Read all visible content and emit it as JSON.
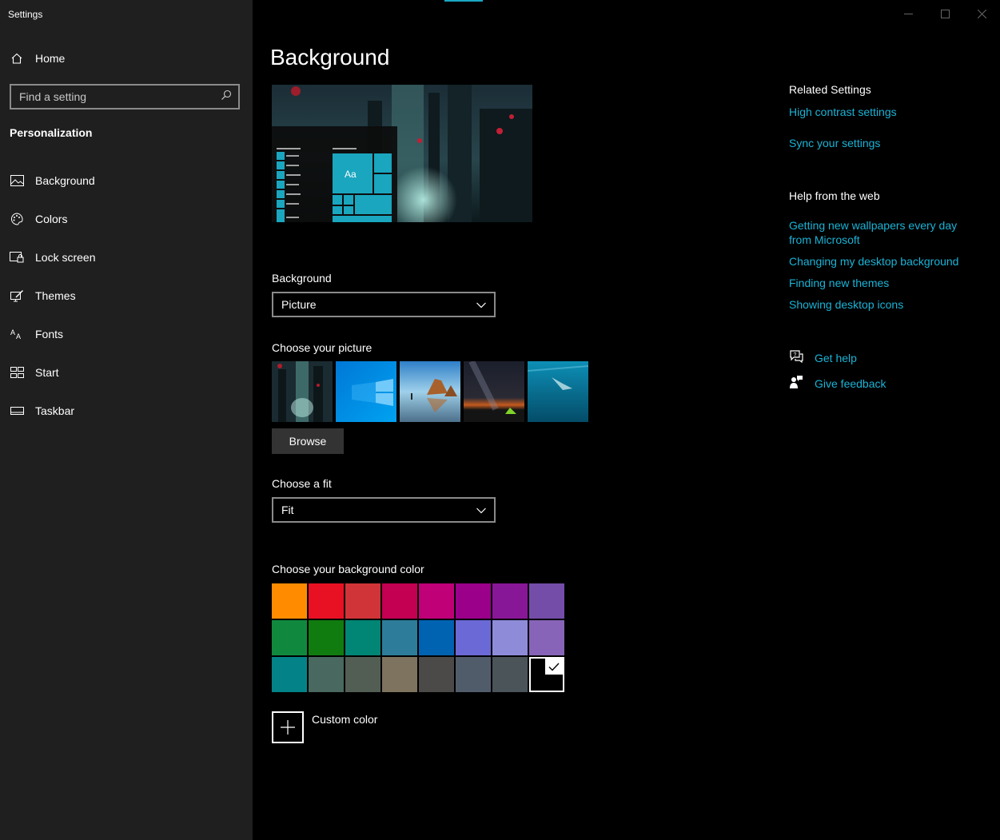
{
  "window": {
    "title": "Settings"
  },
  "sidebar": {
    "home_label": "Home",
    "search_placeholder": "Find a setting",
    "section_title": "Personalization",
    "items": [
      {
        "label": "Background",
        "icon": "picture-icon"
      },
      {
        "label": "Colors",
        "icon": "palette-icon"
      },
      {
        "label": "Lock screen",
        "icon": "lock-screen-icon"
      },
      {
        "label": "Themes",
        "icon": "themes-icon"
      },
      {
        "label": "Fonts",
        "icon": "fonts-icon"
      },
      {
        "label": "Start",
        "icon": "start-icon"
      },
      {
        "label": "Taskbar",
        "icon": "taskbar-icon"
      }
    ]
  },
  "main": {
    "title": "Background",
    "preview_tile_label": "Aa",
    "background_label": "Background",
    "background_value": "Picture",
    "choose_picture_label": "Choose your picture",
    "browse_label": "Browse",
    "fit_label": "Choose a fit",
    "fit_value": "Fit",
    "color_label": "Choose your background color",
    "colors": [
      "#ff8c00",
      "#e81123",
      "#d13438",
      "#c30052",
      "#bf0077",
      "#9a0089",
      "#881798",
      "#744da9",
      "#10893e",
      "#107c10",
      "#018574",
      "#2d7d9a",
      "#0063b1",
      "#6b69d6",
      "#8e8cd8",
      "#8764b8",
      "#038387",
      "#486860",
      "#525e54",
      "#7e735f",
      "#4c4a48",
      "#515c6b",
      "#4a5459",
      "#000000"
    ],
    "selected_color_index": 23,
    "custom_color_label": "Custom color"
  },
  "related": {
    "heading": "Related Settings",
    "links": [
      "High contrast settings",
      "Sync your settings"
    ]
  },
  "help_web": {
    "heading": "Help from the web",
    "links": [
      "Getting new wallpapers every day from Microsoft",
      "Changing my desktop background",
      "Finding new themes",
      "Showing desktop icons"
    ]
  },
  "support": {
    "get_help": "Get help",
    "give_feedback": "Give feedback"
  },
  "accent_color": "#1ab3d6"
}
